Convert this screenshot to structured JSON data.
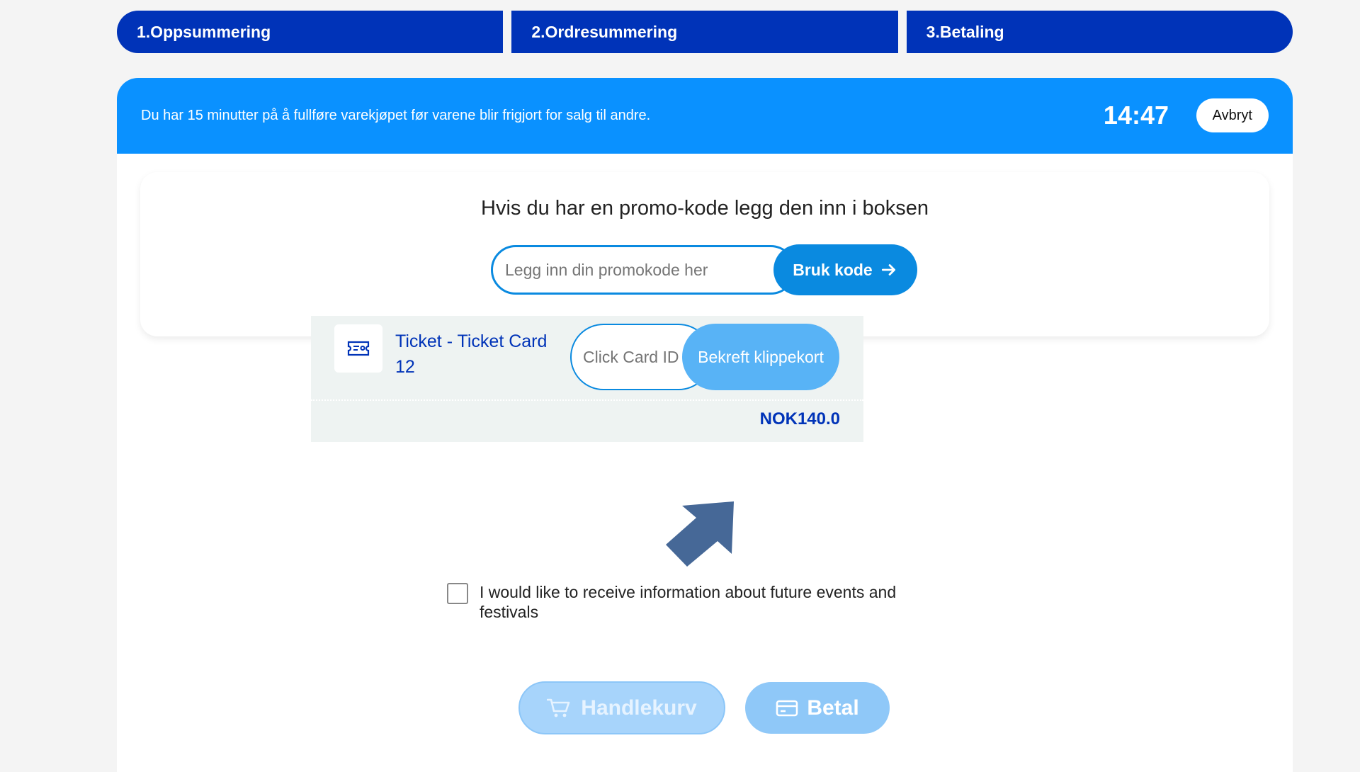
{
  "steps": [
    "1.Oppsummering",
    "2.Ordresummering",
    "3.Betaling"
  ],
  "banner": {
    "message": "Du har 15 minutter på å fullføre varekjøpet før varene blir frigjort for salg til andre.",
    "timer": "14:47",
    "cancel_label": "Avbryt"
  },
  "promo": {
    "title": "Hvis du har en promo-kode legg den inn i boksen",
    "placeholder": "Legg inn din promokode her",
    "button_label": "Bruk kode"
  },
  "ticket": {
    "name": "Ticket - Ticket Card 12",
    "card_placeholder": "Click Card ID",
    "confirm_label": "Bekreft klippekort",
    "price": "NOK140.0"
  },
  "newsletter": {
    "label": "I would like to receive information about future events and festivals",
    "checked": false
  },
  "actions": {
    "cart_label": "Handlekurv",
    "pay_label": "Betal"
  },
  "colors": {
    "step_bg": "#0033b8",
    "banner_bg": "#0a91ff",
    "accent": "#0a8ae0",
    "disabled_button": "#a7d4fb"
  }
}
